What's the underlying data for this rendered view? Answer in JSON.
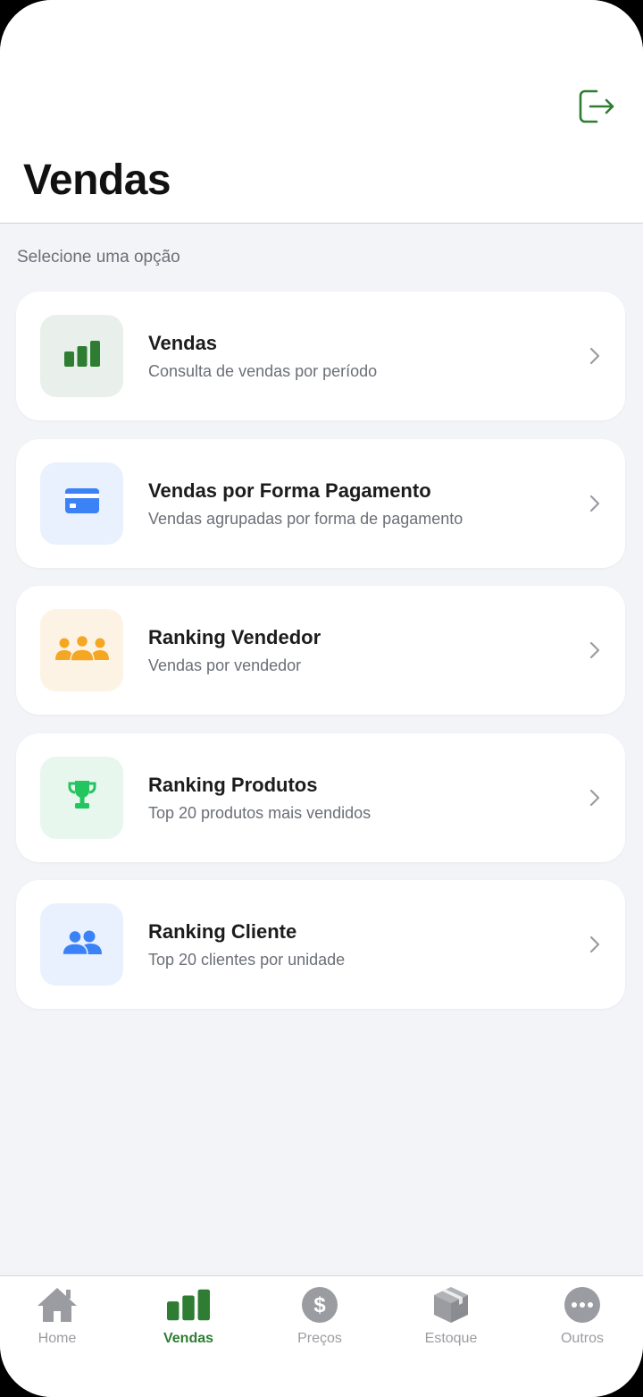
{
  "header": {
    "title": "Vendas",
    "logout_icon": "logout-icon"
  },
  "section_label": "Selecione uma opção",
  "menu_items": [
    {
      "title": "Vendas",
      "subtitle": "Consulta de vendas por período",
      "icon": "bar-chart-icon",
      "icon_color": "#2e7d32",
      "icon_bg": "#e9efeb"
    },
    {
      "title": "Vendas por Forma Pagamento",
      "subtitle": "Vendas agrupadas por forma de pagamento",
      "icon": "credit-card-icon",
      "icon_color": "#3b82f6",
      "icon_bg": "#e8f1fd"
    },
    {
      "title": "Ranking Vendedor",
      "subtitle": "Vendas por vendedor",
      "icon": "group-icon",
      "icon_color": "#f5a623",
      "icon_bg": "#fdf3e4"
    },
    {
      "title": "Ranking Produtos",
      "subtitle": "Top 20 produtos mais vendidos",
      "icon": "trophy-icon",
      "icon_color": "#22c55e",
      "icon_bg": "#e8f7ee"
    },
    {
      "title": "Ranking Cliente",
      "subtitle": "Top 20 clientes por unidade",
      "icon": "users-icon",
      "icon_color": "#3b82f6",
      "icon_bg": "#e8f1fd"
    }
  ],
  "tabbar": {
    "active_color": "#2e7d32",
    "inactive_color": "#9a9ca1",
    "tabs": [
      {
        "label": "Home",
        "icon": "home-icon",
        "active": false
      },
      {
        "label": "Vendas",
        "icon": "bar-chart-icon",
        "active": true
      },
      {
        "label": "Preços",
        "icon": "dollar-icon",
        "active": false
      },
      {
        "label": "Estoque",
        "icon": "box-icon",
        "active": false
      },
      {
        "label": "Outros",
        "icon": "more-icon",
        "active": false
      }
    ]
  }
}
